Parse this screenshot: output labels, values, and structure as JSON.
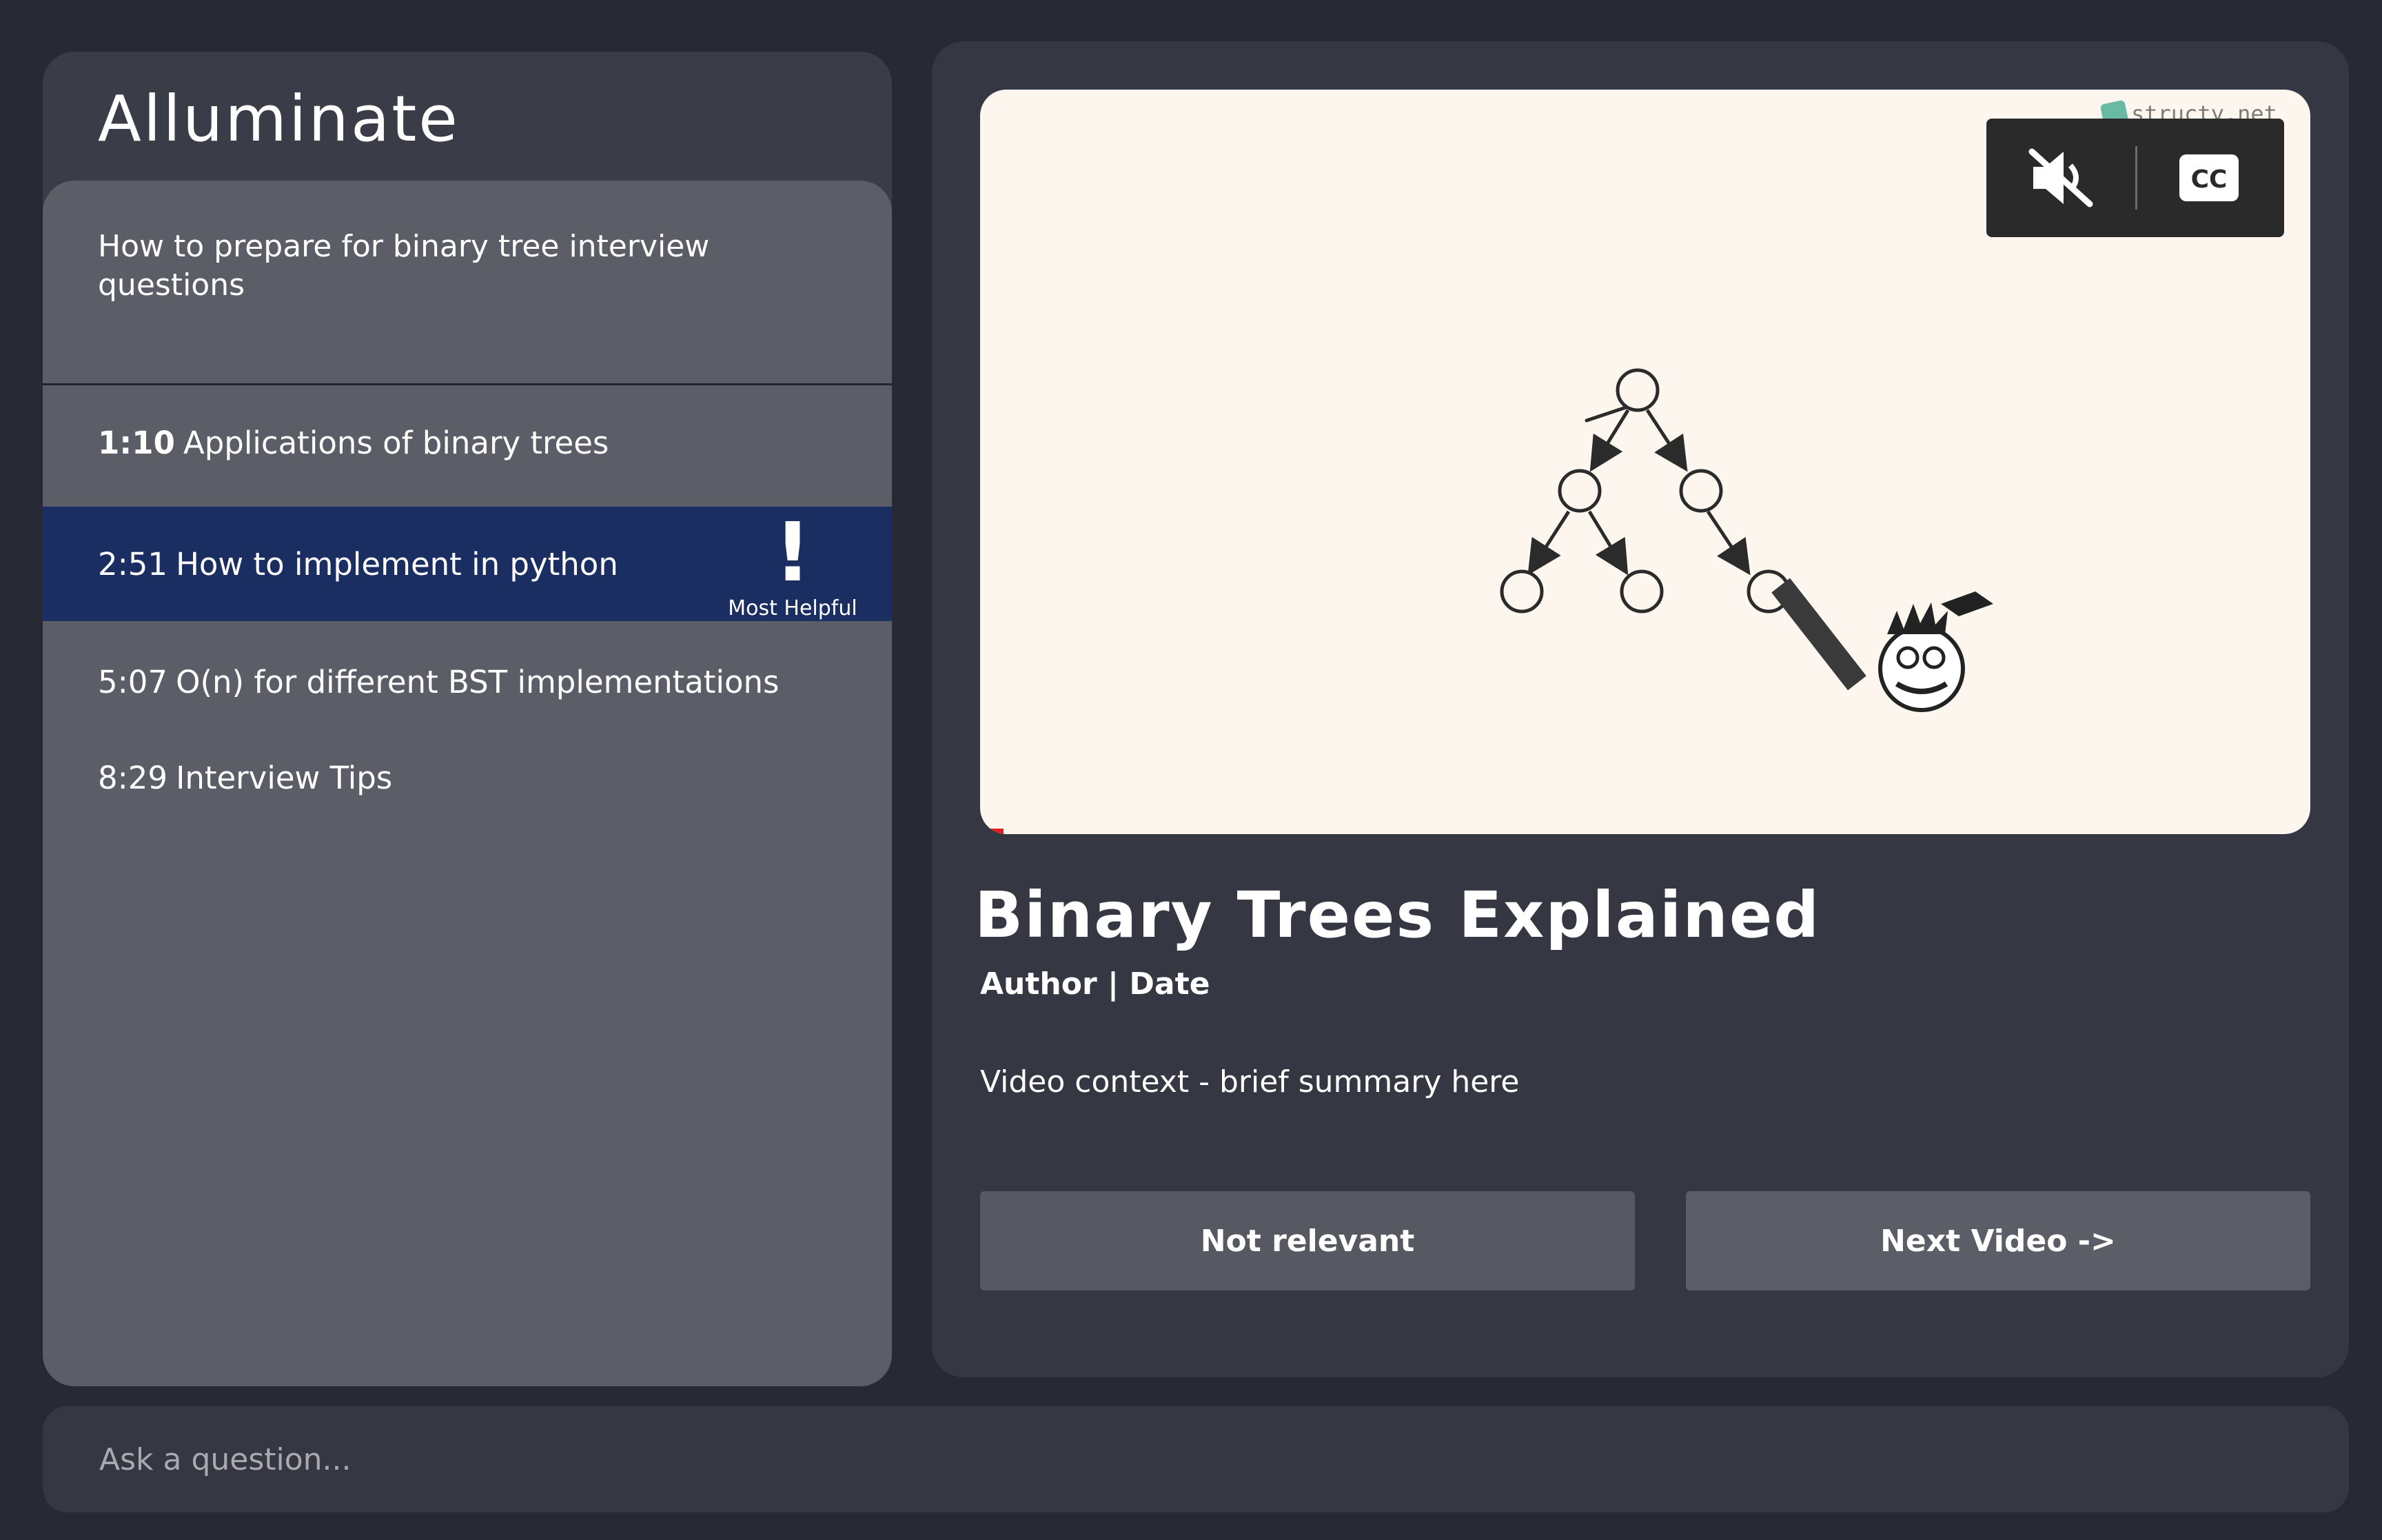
{
  "app": {
    "title": "Alluminate"
  },
  "chapters": {
    "header": "How to prepare for binary tree interview questions",
    "items": [
      {
        "timestamp": "1:10",
        "label": "Applications of binary trees"
      },
      {
        "timestamp": "2:51",
        "label": "How to implement in python",
        "badge": "Most Helpful",
        "badge_mark": "!"
      },
      {
        "timestamp": "5:07",
        "label": "O(n) for different BST implementations"
      },
      {
        "timestamp": "8:29",
        "label": "Interview Tips"
      }
    ]
  },
  "video": {
    "watermark": "structy.net",
    "controls": {
      "mute_icon": "speaker-muted-icon",
      "cc_icon": "closed-captions-icon",
      "cc_label": "CC"
    },
    "title": "Binary Trees Explained",
    "meta": "Author | Date",
    "summary": "Video context - brief summary here"
  },
  "actions": {
    "not_relevant": "Not relevant",
    "next_video": "Next Video ->"
  },
  "ask": {
    "placeholder": "Ask a question..."
  },
  "colors": {
    "background": "#272a35",
    "panel": "#353843",
    "chapter_card": "#5b5e66",
    "active_chapter": "#1b2e62",
    "video_bg": "#fdf6ef"
  }
}
